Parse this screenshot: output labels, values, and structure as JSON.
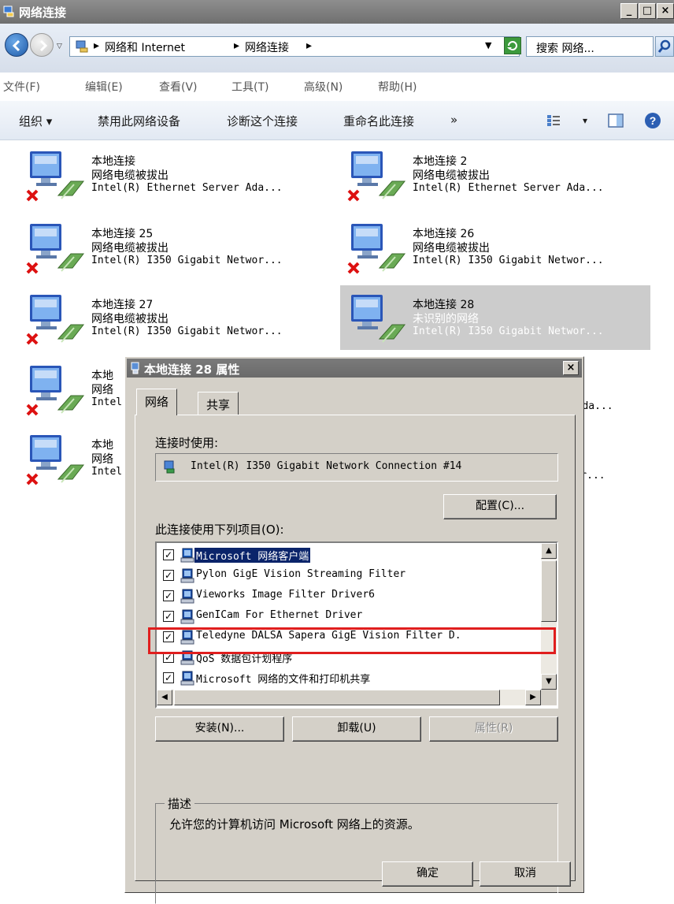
{
  "window": {
    "title": "网络连接",
    "min_label": "_",
    "max_label": "□",
    "close_label": "×"
  },
  "address": {
    "sep1": "▸",
    "crumb1": "网络和 Internet",
    "sep2": "▸",
    "crumb2": "网络连接",
    "sep3": "▸",
    "search_placeholder": "搜索 网络..."
  },
  "menu": {
    "file": "文件(F)",
    "edit": "编辑(E)",
    "view": "查看(V)",
    "tools": "工具(T)",
    "advanced": "高级(N)",
    "help": "帮助(H)"
  },
  "commands": {
    "organize": "组织 ▾",
    "disable": "禁用此网络设备",
    "diagnose": "诊断这个连接",
    "rename": "重命名此连接",
    "more": "»",
    "views_arrow": "▾"
  },
  "connections": [
    {
      "name": "本地连接",
      "status": "网络电缆被拔出",
      "adapter": "Intel(R) Ethernet Server Ada..."
    },
    {
      "name": "本地连接 2",
      "status": "网络电缆被拔出",
      "adapter": "Intel(R) Ethernet Server Ada..."
    },
    {
      "name": "本地连接 25",
      "status": "网络电缆被拔出",
      "adapter": "Intel(R) I350 Gigabit Networ..."
    },
    {
      "name": "本地连接 26",
      "status": "网络电缆被拔出",
      "adapter": "Intel(R) I350 Gigabit Networ..."
    },
    {
      "name": "本地连接 27",
      "status": "网络电缆被拔出",
      "adapter": "Intel(R) I350 Gigabit Networ..."
    },
    {
      "name": "本地连接 28",
      "status": "未识别的网络",
      "adapter": "Intel(R) I350 Gigabit Networ..."
    },
    {
      "name": "本地",
      "status": "网络",
      "adapter": "Intel"
    },
    {
      "name": "",
      "status": "",
      "adapter": "r Ada..."
    },
    {
      "name": "本地",
      "status": "网络",
      "adapter": "Intel"
    },
    {
      "name": "",
      "status": "",
      "adapter": "etwor..."
    }
  ],
  "dialog": {
    "title": "本地连接 28 属性",
    "close_label": "×",
    "tab_network": "网络",
    "tab_sharing": "共享",
    "connect_using_label": "连接时使用:",
    "adapter_name": "Intel(R) I350 Gigabit Network Connection #14",
    "configure_button": "配置(C)...",
    "items_label": "此连接使用下列项目(O):",
    "items": [
      {
        "checked": "✓",
        "label": "Microsoft 网络客户端"
      },
      {
        "checked": "✓",
        "label": "Pylon GigE Vision Streaming Filter"
      },
      {
        "checked": "✓",
        "label": "Vieworks Image Filter Driver6"
      },
      {
        "checked": "✓",
        "label": "GenICam For Ethernet Driver"
      },
      {
        "checked": "✓",
        "label": "Teledyne DALSA Sapera GigE Vision Filter D."
      },
      {
        "checked": "✓",
        "label": "QoS 数据包计划程序"
      },
      {
        "checked": "✓",
        "label": "Microsoft 网络的文件和打印机共享"
      }
    ],
    "install_button": "安装(N)...",
    "uninstall_button": "卸载(U)",
    "properties_button": "属性(R)",
    "description_title": "描述",
    "description_text": "允许您的计算机访问 Microsoft 网络上的资源。",
    "ok_button": "确定",
    "cancel_button": "取消",
    "scroll_up": "▲",
    "scroll_down": "▼",
    "scroll_left": "◀",
    "scroll_right": "▶"
  },
  "colors": {
    "highlight": "#0a246a",
    "annotation_red": "#e01e1e",
    "dialog_face": "#d4d0c8"
  }
}
